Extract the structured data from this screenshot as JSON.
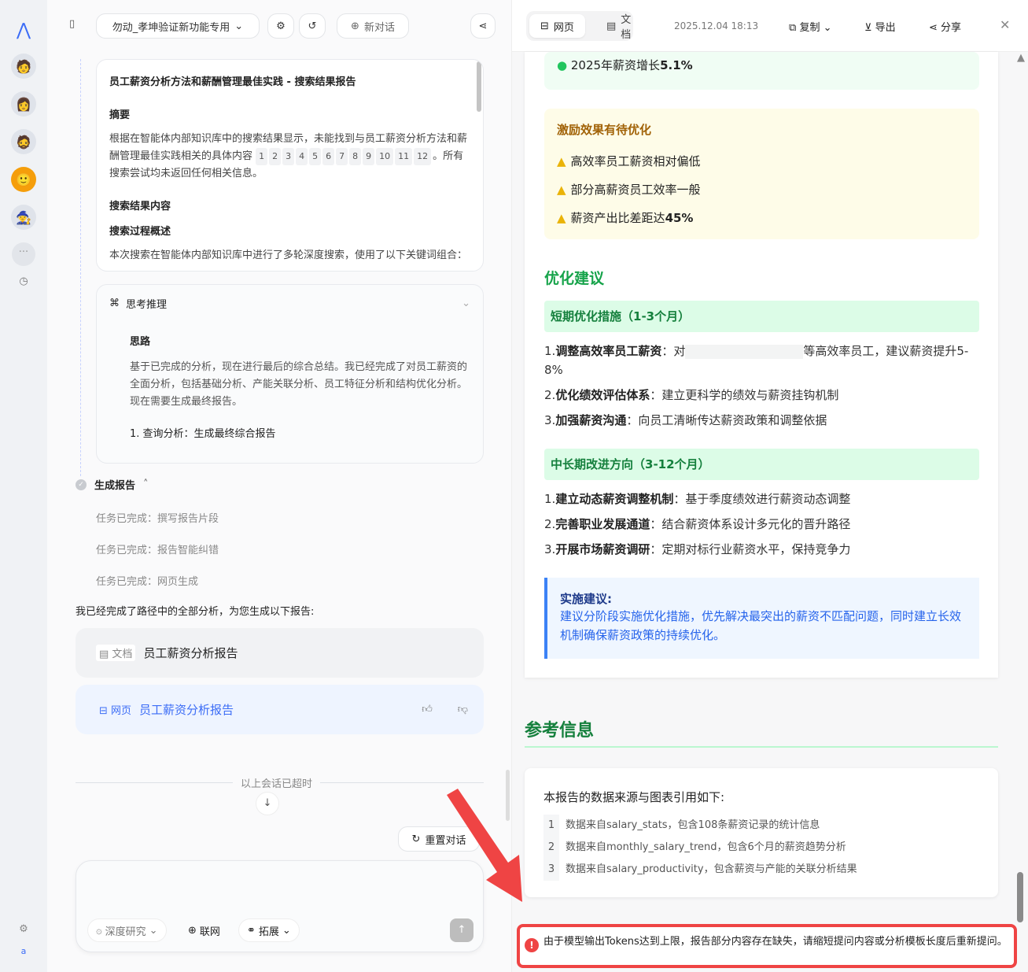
{
  "sidebar": {
    "bottom_user": "a"
  },
  "left": {
    "agent_select": "勿动_孝坤验证新功能专用",
    "new_chat": "新对话",
    "search_card": {
      "title": "员工薪资分析方法和薪酬管理最佳实践 - 搜索结果报告",
      "summary_heading": "摘要",
      "summary_text": "根据在智能体内部知识库中的搜索结果显示，未能找到与员工薪资分析方法和薪酬管理最佳实践相关的具体内容",
      "refs": [
        "1",
        "2",
        "3",
        "4",
        "5",
        "6",
        "7",
        "8",
        "9",
        "10",
        "11",
        "12"
      ],
      "summary_tail": "。所有搜索尝试均未返回任何相关信息。",
      "results_heading": "搜索结果内容",
      "process_heading": "搜索过程概述",
      "process_text": "本次搜索在智能体内部知识库中进行了多轮深度搜索，使用了以下关键词组合："
    },
    "thinking": {
      "title": "思考推理",
      "subtitle": "思路",
      "text": "基于已完成的分析，现在进行最后的综合总结。我已经完成了对员工薪资的全面分析，包括基础分析、产能关联分析、员工特征分析和结构优化分析。现在需要生成最终报告。",
      "step": "1. 查询分析：生成最终综合报告"
    },
    "generate": {
      "title": "生成报告",
      "tasks": [
        "任务已完成：撰写报告片段",
        "任务已完成：报告智能纠错",
        "任务已完成：网页生成"
      ]
    },
    "done_text": "我已经完成了路径中的全部分析，为您生成以下报告:",
    "doc_card": {
      "tag": "文档",
      "title": "员工薪资分析报告"
    },
    "web_card": {
      "tag": "网页",
      "title": "员工薪资分析报告"
    },
    "timeout": "以上会话已超时",
    "reset": "重置对话",
    "input": {
      "placeholder": "",
      "deep": "深度研究",
      "web": "联网",
      "ext": "拓展"
    }
  },
  "right": {
    "tabs": [
      "网页",
      "文档"
    ],
    "timestamp": "2025.12.04 18:13",
    "copy": "复制",
    "export": "导出",
    "share": "分享",
    "growth": {
      "text": "2025年薪资增长",
      "value": "5.1%"
    },
    "incentive": {
      "title": "激励效果有待优化",
      "items": [
        {
          "text": "高效率员工薪资相对偏低",
          "bold": ""
        },
        {
          "text": "部分高薪资员工效率一般",
          "bold": ""
        },
        {
          "text": "薪资产出比差距达",
          "bold": "45%"
        }
      ]
    },
    "opt_title": "优化建议",
    "short": {
      "title": "短期优化措施（1-3个月）",
      "items": [
        {
          "n": "1.",
          "b": "调整高效率员工薪资",
          "t": "：对",
          "t2": "等高效率员工，建议薪资提升5-8%"
        },
        {
          "n": "2.",
          "b": "优化绩效评估体系",
          "t": "：建立更科学的绩效与薪资挂钩机制"
        },
        {
          "n": "3.",
          "b": "加强薪资沟通",
          "t": "：向员工清晰传达薪资政策和调整依据"
        }
      ]
    },
    "mid": {
      "title": "中长期改进方向（3-12个月）",
      "items": [
        {
          "n": "1.",
          "b": "建立动态薪资调整机制",
          "t": "：基于季度绩效进行薪资动态调整"
        },
        {
          "n": "2.",
          "b": "完善职业发展通道",
          "t": "：结合薪资体系设计多元化的晋升路径"
        },
        {
          "n": "3.",
          "b": "开展市场薪资调研",
          "t": "：定期对标行业薪资水平，保持竞争力"
        }
      ]
    },
    "impl": {
      "title": "实施建议:",
      "text": "建议分阶段实施优化措施，优先解决最突出的薪资不匹配问题，同时建立长效机制确保薪资政策的持续优化。"
    },
    "ref_title": "参考信息",
    "ref_intro": "本报告的数据来源与图表引用如下:",
    "refs": [
      {
        "n": "1",
        "t": "数据来自salary_stats，包含108条薪资记录的统计信息"
      },
      {
        "n": "2",
        "t": "数据来自monthly_salary_trend，包含6个月的薪资趋势分析"
      },
      {
        "n": "3",
        "t": "数据来自salary_productivity，包含薪资与产能的关联分析结果"
      }
    ],
    "error": "由于模型输出Tokens达到上限，报告部分内容存在缺失，请缩短提问内容或分析模板长度后重新提问。"
  },
  "colors": {
    "accent": "#3b6cf6",
    "green": "#15803d",
    "annotation": "#ef4444"
  }
}
